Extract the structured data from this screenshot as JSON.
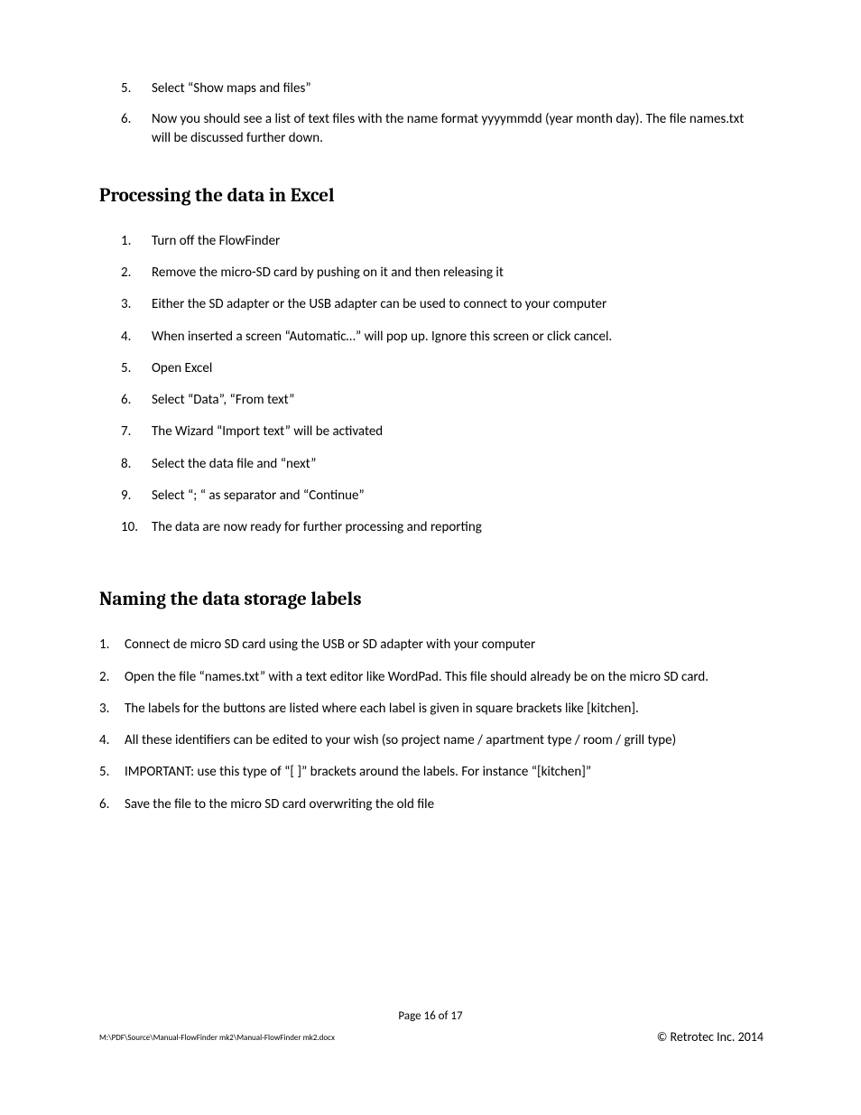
{
  "cont_list": [
    {
      "n": "5.",
      "t": "Select “Show maps and files”"
    },
    {
      "n": "6.",
      "t": "Now you should see a list of text files with the name format yyyymmdd (year month day). The file names.txt will be discussed further down."
    }
  ],
  "heading_excel": "Processing the data in Excel",
  "excel_list": [
    {
      "n": "1.",
      "t": "Turn off the FlowFinder"
    },
    {
      "n": "2.",
      "t": "Remove the micro-SD card by pushing on it and then releasing it"
    },
    {
      "n": "3.",
      "t": "Either the SD adapter or the USB adapter can be used to connect to your computer"
    },
    {
      "n": "4.",
      "t": "When inserted a screen “Automatic…” will pop up. Ignore this screen or click cancel."
    },
    {
      "n": "5.",
      "t": "Open Excel"
    },
    {
      "n": "6.",
      "t": "Select “Data”, “From text”"
    },
    {
      "n": "7.",
      "t": "The Wizard “Import text” will be activated"
    },
    {
      "n": "8.",
      "t": "Select the data file and “next”"
    },
    {
      "n": "9.",
      "t": "Select “; “ as separator and “Continue”"
    },
    {
      "n": "10.",
      "t": "The data are now ready for further processing and reporting"
    }
  ],
  "heading_naming": "Naming the data storage labels",
  "naming_list": [
    {
      "n": "1.",
      "t": "Connect de micro SD card using the USB or SD adapter with your computer"
    },
    {
      "n": "2.",
      "t": "Open the file “names.txt” with a text editor like WordPad. This file should already be on the micro SD card."
    },
    {
      "n": "3.",
      "t": "The labels for the buttons are listed where each label is given in square brackets like [kitchen]."
    },
    {
      "n": "4.",
      "t": "All these identifiers can be edited  to your wish (so project name / apartment type / room / grill type)"
    },
    {
      "n": "5.",
      "t": "IMPORTANT: use this type of “[ ]” brackets around the labels. For instance “[kitchen]”"
    },
    {
      "n": "6.",
      "t": "Save the file to the micro SD card overwriting the old file"
    }
  ],
  "footer": {
    "page": "Page 16 of 17",
    "path": "M:\\PDF\\Source\\Manual-FlowFinder mk2\\Manual-FlowFinder mk2.docx",
    "copyright": "© Retrotec Inc. 2014"
  }
}
